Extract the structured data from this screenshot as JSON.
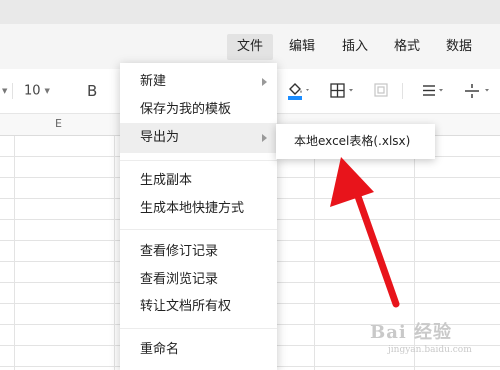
{
  "menubar": {
    "items": [
      {
        "label": "文件",
        "active": true
      },
      {
        "label": "编辑"
      },
      {
        "label": "插入"
      },
      {
        "label": "格式"
      },
      {
        "label": "数据"
      }
    ]
  },
  "toolbar": {
    "font_size": "10",
    "bold": "B"
  },
  "sheet": {
    "column_letter": "E"
  },
  "file_menu": {
    "items": [
      {
        "label": "新建",
        "has_submenu": true
      },
      {
        "label": "保存为我的模板"
      },
      {
        "label": "导出为",
        "has_submenu": true,
        "highlighted": true
      },
      {
        "label": "生成副本"
      },
      {
        "label": "生成本地快捷方式"
      },
      {
        "label": "查看修订记录"
      },
      {
        "label": "查看浏览记录"
      },
      {
        "label": "转让文档所有权"
      },
      {
        "label": "重命名"
      }
    ]
  },
  "export_submenu": {
    "items": [
      {
        "label": "本地excel表格(.xlsx)"
      }
    ]
  },
  "annotation": {
    "arrow_color": "#e8141b"
  },
  "watermark": {
    "text": "Bai 经验",
    "sub": "jingyan.baidu.com"
  },
  "colors": {
    "menubar_bg": "#f5f5f5",
    "active_menu_bg": "#e3e3e3",
    "hover_item_bg": "#eeeeee",
    "fill_color_swatch": "#1a8cff"
  }
}
